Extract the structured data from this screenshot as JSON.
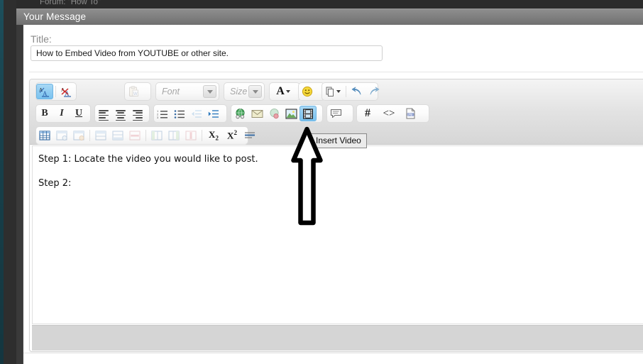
{
  "browser": {
    "forum_breadcrumb": "Forum: \"How To\""
  },
  "panel": {
    "header_title": "Your Message"
  },
  "form": {
    "title_label": "Title:",
    "title_value": "How to Embed Video from YOUTUBE or other site."
  },
  "toolbar": {
    "row1": [
      {
        "name": "spellcheck-toggle-icon",
        "glyph": "A̲A",
        "state": "active"
      },
      {
        "name": "remove-spellcheck-icon",
        "glyph": "A̶A",
        "state": "normal"
      },
      {
        "name": "paste-word-icon",
        "glyph": "clipboard",
        "state": "disabled"
      },
      {
        "name": "font-family-dropdown",
        "glyph": "",
        "state": "normal"
      },
      {
        "name": "font-size-dropdown",
        "glyph": "",
        "state": "normal"
      },
      {
        "name": "text-color-icon",
        "glyph": "A",
        "state": "normal"
      },
      {
        "name": "emoticon-icon",
        "glyph": "smiley",
        "state": "normal"
      },
      {
        "name": "attachment-icon",
        "glyph": "paperclip",
        "state": "normal"
      },
      {
        "name": "undo-icon",
        "glyph": "undo",
        "state": "normal"
      },
      {
        "name": "redo-icon",
        "glyph": "redo",
        "state": "normal"
      }
    ],
    "font_dropdown_label": "Font",
    "size_dropdown_label": "Size",
    "row2": [
      {
        "name": "bold-icon",
        "glyph": "B",
        "state": "normal"
      },
      {
        "name": "italic-icon",
        "glyph": "I",
        "state": "normal"
      },
      {
        "name": "underline-icon",
        "glyph": "U",
        "state": "normal"
      },
      {
        "name": "align-left-icon",
        "glyph": "align-left",
        "state": "normal"
      },
      {
        "name": "align-center-icon",
        "glyph": "align-center",
        "state": "normal"
      },
      {
        "name": "align-right-icon",
        "glyph": "align-right",
        "state": "normal"
      },
      {
        "name": "ordered-list-icon",
        "glyph": "ol",
        "state": "normal"
      },
      {
        "name": "unordered-list-icon",
        "glyph": "ul",
        "state": "normal"
      },
      {
        "name": "outdent-icon",
        "glyph": "outdent",
        "state": "dim"
      },
      {
        "name": "indent-icon",
        "glyph": "indent",
        "state": "normal"
      },
      {
        "name": "insert-link-icon",
        "glyph": "globe",
        "state": "normal"
      },
      {
        "name": "insert-email-icon",
        "glyph": "envelope",
        "state": "normal"
      },
      {
        "name": "remove-link-icon",
        "glyph": "globe-broken",
        "state": "normal"
      },
      {
        "name": "insert-image-icon",
        "glyph": "picture",
        "state": "normal"
      },
      {
        "name": "insert-video-icon",
        "glyph": "film",
        "state": "active"
      },
      {
        "name": "insert-quote-icon",
        "glyph": "speech-bubble",
        "state": "normal"
      },
      {
        "name": "insert-hash-icon",
        "glyph": "#",
        "state": "normal"
      },
      {
        "name": "insert-code-icon",
        "glyph": "<>",
        "state": "normal"
      },
      {
        "name": "insert-php-icon",
        "glyph": "php",
        "state": "normal"
      }
    ],
    "row3": [
      {
        "name": "insert-table-icon",
        "glyph": "table",
        "state": "normal"
      },
      {
        "name": "table-properties-icon",
        "glyph": "table-props",
        "state": "dim"
      },
      {
        "name": "delete-table-icon",
        "glyph": "table-del",
        "state": "dim"
      },
      {
        "name": "insert-row-before-icon",
        "glyph": "row-before",
        "state": "dim"
      },
      {
        "name": "insert-row-after-icon",
        "glyph": "row-after",
        "state": "dim"
      },
      {
        "name": "delete-row-icon",
        "glyph": "row-del",
        "state": "dim"
      },
      {
        "name": "insert-column-before-icon",
        "glyph": "col-before",
        "state": "dim"
      },
      {
        "name": "insert-column-after-icon",
        "glyph": "col-after",
        "state": "dim"
      },
      {
        "name": "delete-column-icon",
        "glyph": "col-del",
        "state": "dim"
      },
      {
        "name": "subscript-icon",
        "glyph": "X₂",
        "state": "normal"
      },
      {
        "name": "superscript-icon",
        "glyph": "X²",
        "state": "normal"
      },
      {
        "name": "horizontal-rule-icon",
        "glyph": "hr",
        "state": "normal"
      }
    ]
  },
  "editor_body": {
    "line_1": "Step 1: Locate the video you would like to post.",
    "line_2": "Step 2:"
  },
  "tooltip": {
    "text": "Insert Video"
  },
  "annotation": {
    "type": "hand-drawn-arrow",
    "direction": "up",
    "points_at": "insert-video-icon"
  },
  "colors": {
    "header_bar": "#7e7e7e",
    "highlight_blue": "#79c2ef",
    "toolbar_gray": "#e3e3e3",
    "statusbar_gray": "#d5d5d5",
    "annotation_stroke": "#000000"
  }
}
